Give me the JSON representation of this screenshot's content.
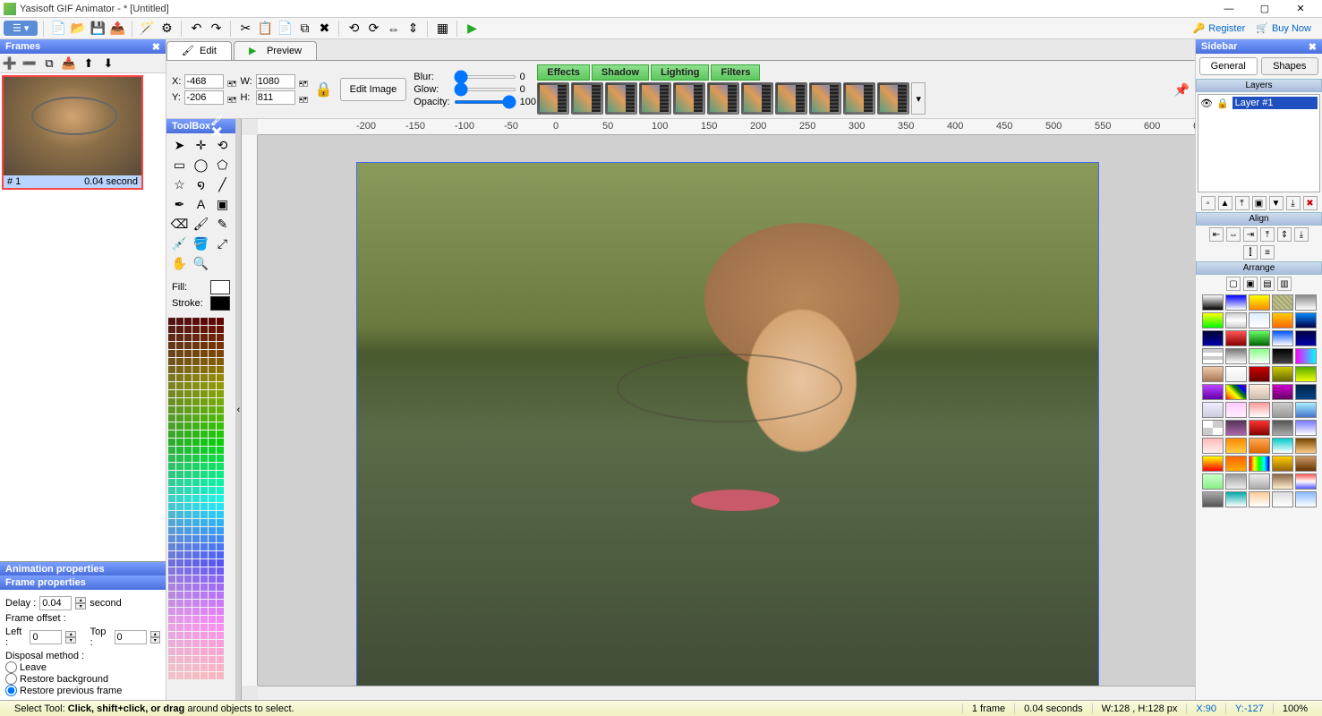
{
  "titlebar": {
    "title": "Yasisoft GIF Animator - * [Untitled]"
  },
  "toolbar": {
    "register": "Register",
    "buynow": "Buy Now"
  },
  "frames": {
    "header": "Frames",
    "thumb": {
      "index": "# 1",
      "duration": "0.04 second"
    },
    "animprops_hdr": "Animation properties",
    "frameprops_hdr": "Frame properties",
    "delay_label": "Delay :",
    "delay_value": "0.04",
    "delay_unit": "second",
    "offset_label": "Frame offset :",
    "left_label": "Left :",
    "left_value": "0",
    "top_label": "Top :",
    "top_value": "0",
    "disposal_label": "Disposal method :",
    "disposal_leave": "Leave",
    "disposal_restorebg": "Restore background",
    "disposal_restoreprev": "Restore previous frame"
  },
  "tabs": {
    "edit": "Edit",
    "preview": "Preview"
  },
  "editbar": {
    "x_label": "X:",
    "x_value": "-468",
    "y_label": "Y:",
    "y_value": "-206",
    "w_label": "W:",
    "w_value": "1080",
    "h_label": "H:",
    "h_value": "811",
    "editimage": "Edit Image",
    "blur_label": "Blur:",
    "blur_value": "0",
    "glow_label": "Glow:",
    "glow_value": "0",
    "opacity_label": "Opacity:",
    "opacity_value": "100",
    "effects": "Effects",
    "shadow": "Shadow",
    "lighting": "Lighting",
    "filters": "Filters"
  },
  "toolbox": {
    "header": "ToolBox",
    "fill_label": "Fill:",
    "stroke_label": "Stroke:"
  },
  "sidebar": {
    "header": "Sidebar",
    "tab_general": "General",
    "tab_shapes": "Shapes",
    "layers_hdr": "Layers",
    "layer_name": "Layer #1",
    "align_hdr": "Align",
    "arrange_hdr": "Arrange"
  },
  "status": {
    "hint_prefix": "Select Tool: ",
    "hint_bold": "Click, shift+click, or drag",
    "hint_suffix": " around objects to select.",
    "frames": "1 frame",
    "seconds": "0.04 seconds",
    "wh": "W:128 , H:128 px",
    "x": "X:90",
    "y": "Y:-127",
    "zoom": "100%"
  }
}
